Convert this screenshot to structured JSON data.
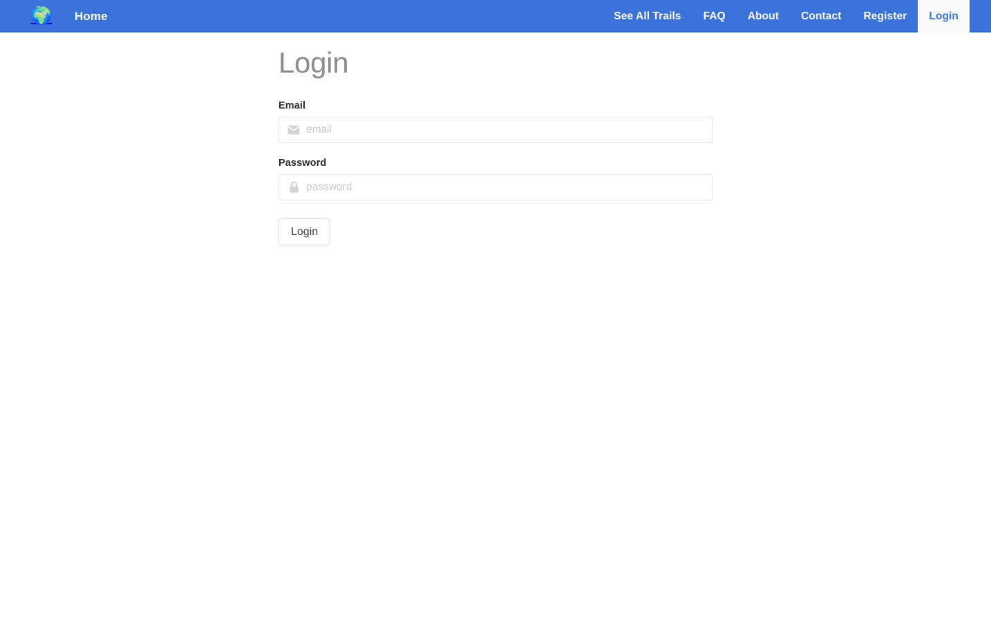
{
  "navbar": {
    "brand": {
      "logo_icon": "globe-earth-icon",
      "logo_glyph": "🌍"
    },
    "home_label": "Home",
    "links": [
      {
        "label": "See All Trails",
        "active": false
      },
      {
        "label": "FAQ",
        "active": false
      },
      {
        "label": "About",
        "active": false
      },
      {
        "label": "Contact",
        "active": false
      },
      {
        "label": "Register",
        "active": false
      },
      {
        "label": "Login",
        "active": true
      }
    ],
    "background_color": "#3a72d9",
    "active_background_color": "#f8f9fa",
    "active_text_color": "#3a72d9",
    "text_color": "#ffffff"
  },
  "main": {
    "title": "Login",
    "title_color": "#8c8c8c",
    "fields": {
      "email": {
        "label": "Email",
        "placeholder": "email",
        "value": "",
        "icon": "envelope-icon"
      },
      "password": {
        "label": "Password",
        "placeholder": "password",
        "value": "",
        "icon": "lock-icon"
      }
    },
    "submit_label": "Login"
  }
}
